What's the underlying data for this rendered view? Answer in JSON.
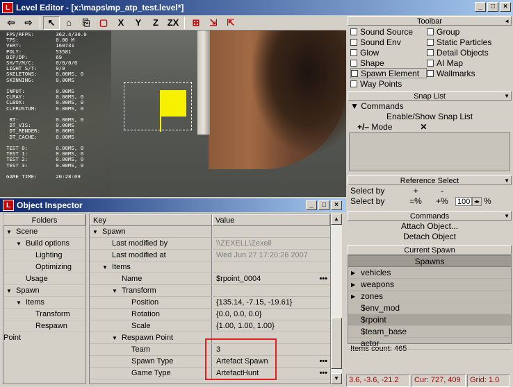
{
  "window": {
    "title": "Level Editor - [x:\\maps\\mp_atp_test.level*]",
    "icon_letter": "L"
  },
  "toolbar_strip": {
    "buttons": [
      "⇦",
      "⇨",
      "↖",
      "⌂",
      "⎘",
      "▢",
      "X",
      "Y",
      "Z",
      "ZX",
      "⊞",
      "⇲",
      "⇱"
    ]
  },
  "viewport": {
    "stats": "FPS/RFPS:       362.4/30.0\nTPS:            0.00 M\nVERT:           160731\nPOLY:           53581\nDIP/DP:         69\nSH/T/M/C:       0/0/0/0\nLIGHT S/T:      0/0\nSKELETONS:      0.00MS, 0\nSKINNING:       0.00MS\n\nINPUT:          0.00MS\nCLRAY:          0.00MS, 0\nCLBOX:          0.00MS, 0\nCLFRUSTUM:      0.00MS, 0\n\n RT:            0.00MS, 0\n DT_VIS:        0.00MS\n DT_RENDER:     0.00MS\n DT_CACHE:      0.00MS\n\nTEST 0:         0.00MS, 0\nTEST 1:         0.00MS, 0\nTEST 2:         0.00MS, 0\nTEST 3:         0.00MS, 0\n\nGAME TIME:      20:28:09"
  },
  "inspector": {
    "title": "Object Inspector",
    "folders_header": "Folders",
    "folders": [
      "Scene",
      "Build options",
      "Lighting",
      "Optimizing",
      "Usage",
      "Spawn",
      "Items",
      "Transform",
      "Respawn Point"
    ],
    "key_header": "Key",
    "value_header": "Value",
    "rows": [
      {
        "k": "Spawn",
        "v": ""
      },
      {
        "k": "Last modified by",
        "v": "\\\\ZEXELL\\Zexell"
      },
      {
        "k": "Last modified at",
        "v": "Wed Jun 27 17:20:26 2007"
      },
      {
        "k": "Items",
        "v": ""
      },
      {
        "k": "Name",
        "v": "$rpoint_0004"
      },
      {
        "k": "Transform",
        "v": ""
      },
      {
        "k": "Position",
        "v": "{135.14, -7.15, -19.61}"
      },
      {
        "k": "Rotation",
        "v": "{0.0, 0.0, 0.0}"
      },
      {
        "k": "Scale",
        "v": "{1.00, 1.00, 1.00}"
      },
      {
        "k": "Respawn Point",
        "v": ""
      },
      {
        "k": "Team",
        "v": "3"
      },
      {
        "k": "Spawn Type",
        "v": "Artefact Spawn"
      },
      {
        "k": "Game Type",
        "v": "ArtefactHunt"
      }
    ]
  },
  "right": {
    "toolbar_title": "Toolbar",
    "checkboxes": [
      "Sound Source",
      "Group",
      "Sound Env",
      "Static Particles",
      "Glow",
      "Detail Objects",
      "Shape",
      "AI Map",
      "Spawn Element",
      "Wallmarks",
      "Way Points"
    ],
    "snap_title": "Snap List",
    "snap_commands": "Commands",
    "snap_enable": "Enable/Show Snap List",
    "snap_mode": "Mode",
    "ref_title": "Reference Select",
    "select_by_1": "Select by",
    "select_by_2": "Select by",
    "sel_plus": "+",
    "sel_minus": "-",
    "sel_eq_pct": "=%",
    "sel_plus_pct": "+%",
    "sel_value": "100",
    "sel_pct": "%",
    "commands_title": "Commands",
    "attach": "Attach Object...",
    "detach": "Detach Object",
    "current_spawn": "Current Spawn",
    "spawns_header": "Spawns",
    "spawns": [
      "vehicles",
      "weapons",
      "zones",
      "$env_mod",
      "$rpoint",
      "$team_base",
      "actor",
      "..."
    ],
    "items_count": "Items count: 465"
  },
  "status": {
    "coords": "3.6, -3.6, -21.2",
    "cur": "Cur: 727, 409",
    "grid": "Grid: 1.0"
  }
}
